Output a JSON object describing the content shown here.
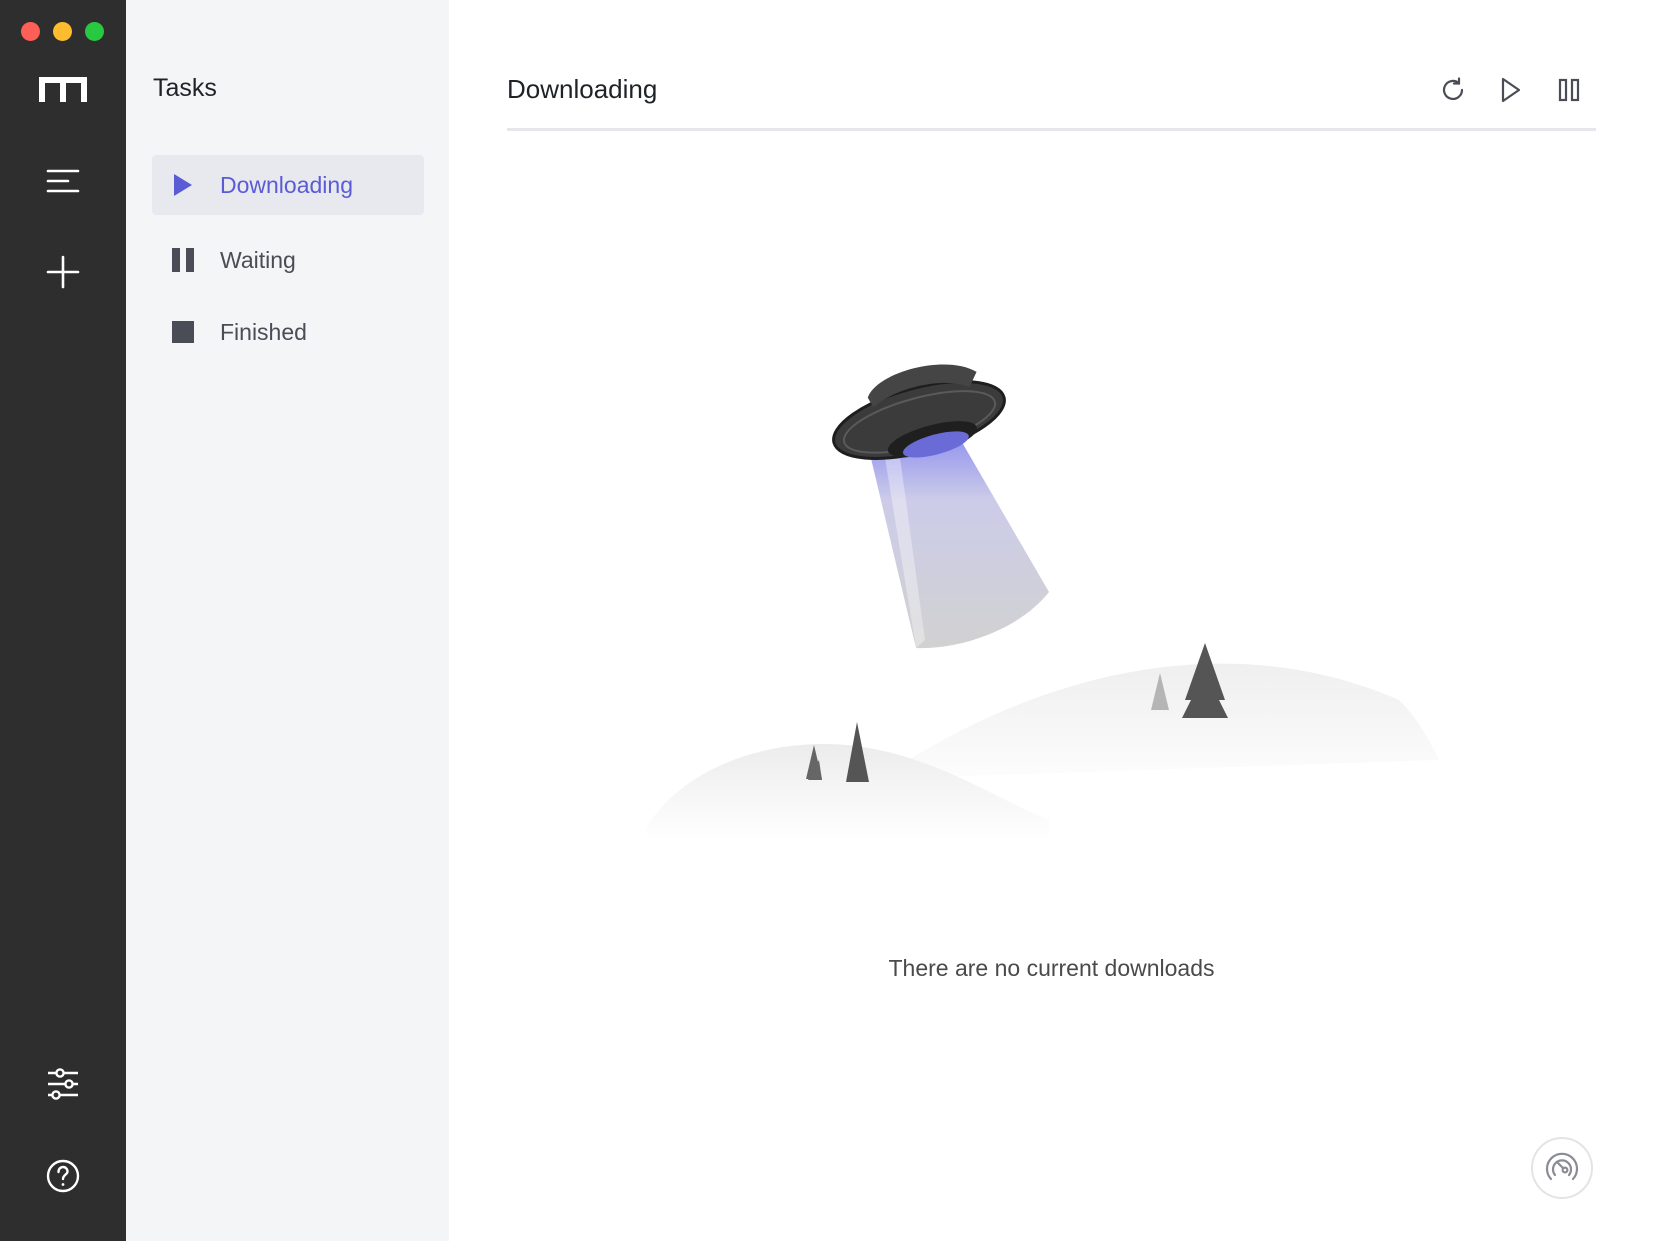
{
  "sidebar_nav": {
    "logo_icon": "motrix-m-icon",
    "items": [
      {
        "name": "menu",
        "icon": "menu-icon"
      },
      {
        "name": "add-task",
        "icon": "plus-icon"
      }
    ],
    "bottom_items": [
      {
        "name": "preferences",
        "icon": "sliders-icon"
      },
      {
        "name": "help",
        "icon": "help-circle-icon"
      }
    ]
  },
  "tasks_panel": {
    "title": "Tasks",
    "items": [
      {
        "label": "Downloading",
        "icon": "play-icon",
        "active": true
      },
      {
        "label": "Waiting",
        "icon": "pause-icon",
        "active": false
      },
      {
        "label": "Finished",
        "icon": "stop-icon",
        "active": false
      }
    ]
  },
  "main": {
    "title": "Downloading",
    "toolbar": {
      "refresh_icon": "refresh-icon",
      "resume_all_icon": "play-outline-icon",
      "pause_all_icon": "pause-outline-icon"
    },
    "empty_message": "There are no current downloads",
    "illustration": "ufo-empty-illustration",
    "speed_icon": "speedometer-icon"
  },
  "colors": {
    "rail_bg": "#2e2e2e",
    "panel_bg": "#f4f5f7",
    "accent": "#5b5bd6",
    "text": "#1f2328"
  }
}
